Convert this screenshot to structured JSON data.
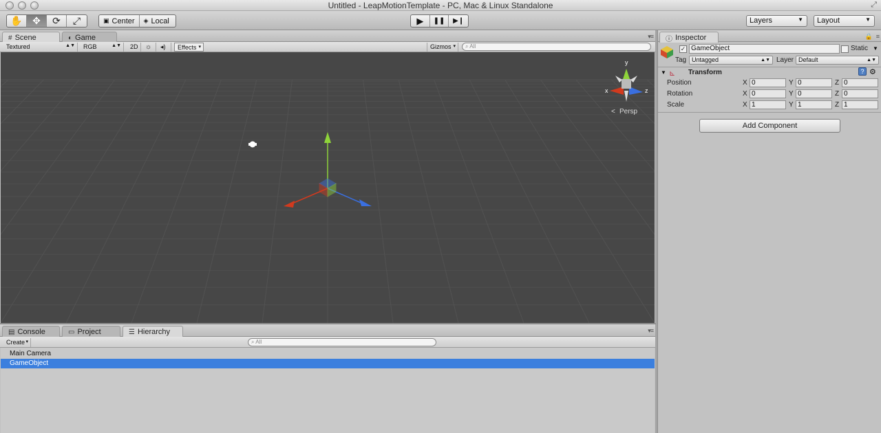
{
  "window": {
    "title": "Untitled - LeapMotionTemplate - PC, Mac & Linux Standalone"
  },
  "toolbar": {
    "transform_tools": [
      {
        "name": "hand-tool",
        "icon": "✋"
      },
      {
        "name": "move-tool",
        "icon": "✥"
      },
      {
        "name": "rotate-tool",
        "icon": "⟳"
      },
      {
        "name": "scale-tool",
        "icon": "⤢"
      }
    ],
    "pivot_label": "Center",
    "space_label": "Local",
    "play_icon": "▶",
    "pause_icon": "❚❚",
    "step_icon": "▶❙",
    "layers_label": "Layers",
    "layout_label": "Layout"
  },
  "scene_panel": {
    "tab_scene": "Scene",
    "tab_game": "Game",
    "shading_mode": "Textured",
    "render_mode": "RGB",
    "mode_2d": "2D",
    "lighting_icon": "☼",
    "audio_icon": "◂)",
    "effects_label": "Effects",
    "gizmos_label": "Gizmos",
    "search_placeholder": "All",
    "projection_label": "Persp",
    "axis_labels": {
      "x": "x",
      "y": "y",
      "z": "z"
    }
  },
  "bottom_panel": {
    "tab_console": "Console",
    "tab_project": "Project",
    "tab_hierarchy": "Hierarchy",
    "create_label": "Create",
    "search_placeholder": "All",
    "items": [
      {
        "label": "Main Camera",
        "selected": false
      },
      {
        "label": "GameObject",
        "selected": true
      }
    ]
  },
  "inspector": {
    "tab_label": "Inspector",
    "object_name": "GameObject",
    "active": true,
    "static_label": "Static",
    "tag_label": "Tag",
    "tag_value": "Untagged",
    "layer_label": "Layer",
    "layer_value": "Default",
    "component_title": "Transform",
    "rows": [
      {
        "label": "Position",
        "x": "0",
        "y": "0",
        "z": "0"
      },
      {
        "label": "Rotation",
        "x": "0",
        "y": "0",
        "z": "0"
      },
      {
        "label": "Scale",
        "x": "1",
        "y": "1",
        "z": "1"
      }
    ],
    "axis_x": "X",
    "axis_y": "Y",
    "axis_z": "Z",
    "add_component_label": "Add Component"
  },
  "colors": {
    "selection": "#3b7fde",
    "axis_x": "#d23a1e",
    "axis_y": "#8fd43a",
    "axis_z": "#3a6fe0",
    "scene_bg": "#474747"
  }
}
